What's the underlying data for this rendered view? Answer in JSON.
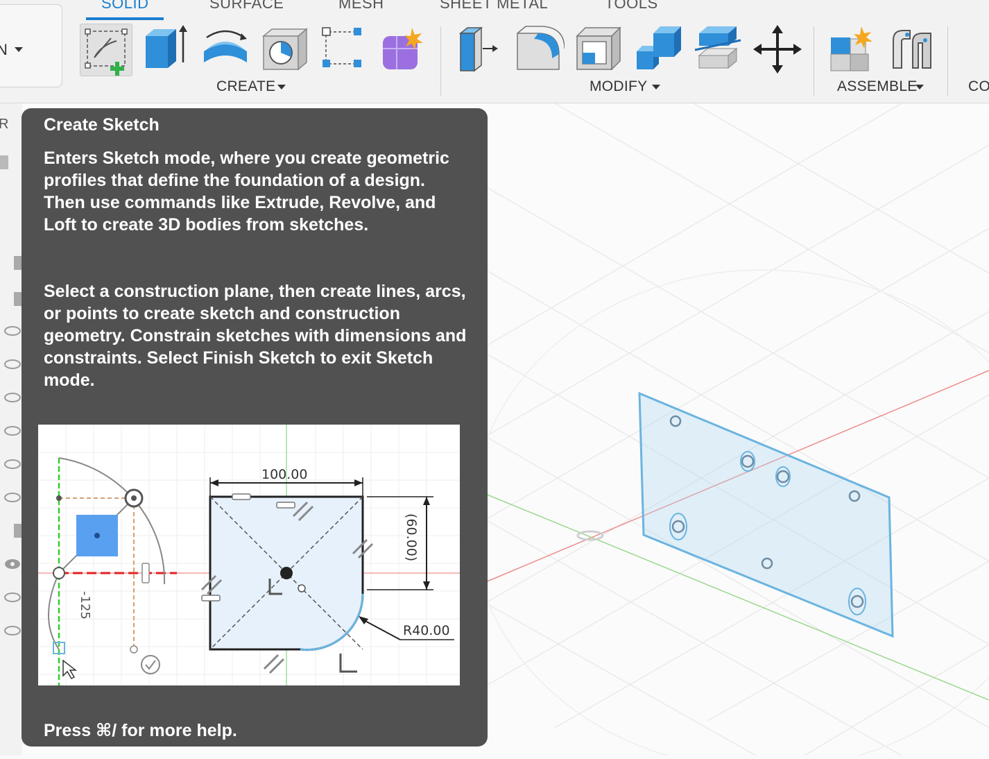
{
  "toolbar": {
    "workspace_label": "N",
    "tabs": [
      {
        "label": "SOLID",
        "active": true
      },
      {
        "label": "SURFACE",
        "active": false
      },
      {
        "label": "MESH",
        "active": false
      },
      {
        "label": "SHEET METAL",
        "active": false
      },
      {
        "label": "TOOLS",
        "active": false
      }
    ],
    "groups": {
      "create": "CREATE",
      "modify": "MODIFY",
      "assemble": "ASSEMBLE",
      "construct": "CO"
    },
    "create_tools": [
      "create-sketch-icon",
      "extrude-icon",
      "revolve-icon",
      "hole-icon",
      "pattern-icon",
      "form-icon"
    ],
    "modify_tools": [
      "press-pull-icon",
      "fillet-icon",
      "shell-icon",
      "combine-icon",
      "split-face-icon",
      "move-icon"
    ],
    "assemble_tools": [
      "new-component-icon",
      "joint-icon"
    ]
  },
  "tooltip": {
    "title": "Create Sketch",
    "paragraph1": "Enters Sketch mode, where you create geometric profiles that define the foundation of a design. Then use commands like Extrude, Revolve, and Loft to create 3D bodies from sketches.",
    "paragraph2": "Select a construction plane, then create lines, arcs, or points to create sketch and construction geometry. Constrain sketches with dimensions and constraints. Select Finish Sketch to exit Sketch mode.",
    "footer": "Press ⌘/ for more help.",
    "illustration": {
      "dim_width": "100.00",
      "dim_height": "(60.00)",
      "dim_radius": "R40.00",
      "dim_neg": "-125"
    }
  },
  "colors": {
    "accent": "#1a7fd0",
    "tooltip_bg": "#515151",
    "sketch_blue": "#6ab4e0",
    "axis_red": "#e05050",
    "axis_green": "#3cb043"
  }
}
